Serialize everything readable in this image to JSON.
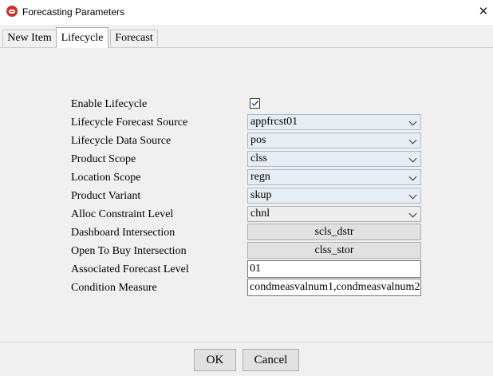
{
  "window": {
    "title": "Forecasting Parameters"
  },
  "tabs": [
    {
      "label": "New Item"
    },
    {
      "label": "Lifecycle"
    },
    {
      "label": "Forecast"
    }
  ],
  "form": {
    "enable_lifecycle": {
      "label": "Enable Lifecycle",
      "checked": true
    },
    "lifecycle_forecast_source": {
      "label": "Lifecycle Forecast Source",
      "value": "appfrcst01"
    },
    "lifecycle_data_source": {
      "label": "Lifecycle Data Source",
      "value": "pos"
    },
    "product_scope": {
      "label": "Product Scope",
      "value": "clss"
    },
    "location_scope": {
      "label": "Location Scope",
      "value": "regn"
    },
    "product_variant": {
      "label": "Product Variant",
      "value": "skup"
    },
    "alloc_constraint_level": {
      "label": "Alloc Constraint Level",
      "value": "chnl"
    },
    "dashboard_intersection": {
      "label": "Dashboard Intersection",
      "value": "scls_dstr"
    },
    "open_to_buy_intersection": {
      "label": "Open To Buy Intersection",
      "value": "clss_stor"
    },
    "associated_forecast_level": {
      "label": "Associated Forecast Level",
      "value": "01"
    },
    "condition_measure": {
      "label": "Condition Measure",
      "value": "condmeasvalnum1,condmeasvalnum2"
    }
  },
  "buttons": {
    "ok": "OK",
    "cancel": "Cancel"
  },
  "icons": {
    "app": "oracle-logo-icon",
    "close": "close-icon",
    "check": "check-icon",
    "dropdown": "chevron-down-icon"
  }
}
